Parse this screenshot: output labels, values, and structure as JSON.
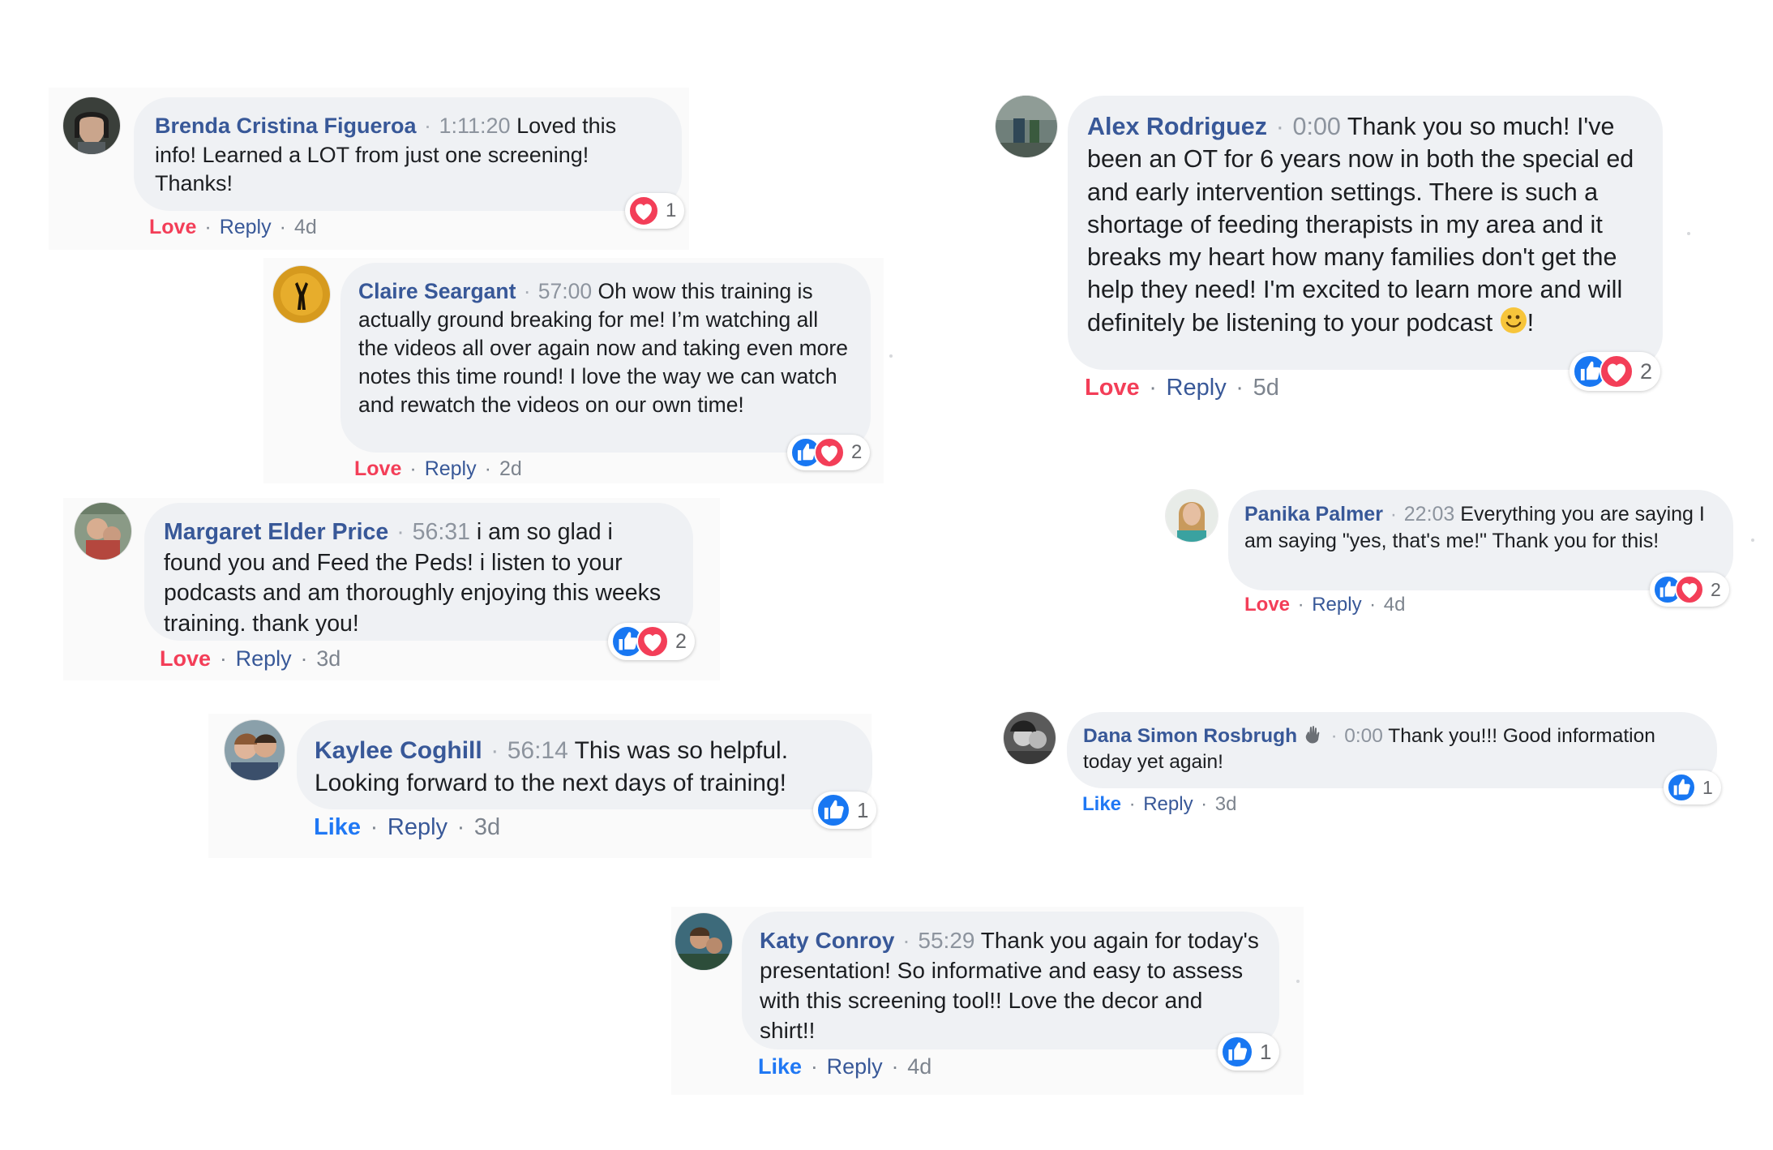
{
  "colors": {
    "bubble": "#eff1f4",
    "author": "#385898",
    "love": "#f33e58",
    "like": "#2078f4",
    "timestamp": "#8d949e"
  },
  "comments": [
    {
      "author": "Brenda Cristina Figueroa",
      "timestamp": "1:11:20",
      "text": "Loved this info! Learned a LOT from just one screening! Thanks!",
      "action": "Love",
      "reply": "Reply",
      "age": "4d",
      "reactions": [
        "love"
      ],
      "reaction_count": "1"
    },
    {
      "author": "Claire Seargant",
      "timestamp": "57:00",
      "text": "Oh wow this training is actually ground breaking for me! I’m watching all the videos all over again now and taking even more notes this time round! I love the way we can watch and rewatch the videos on our own time!",
      "action": "Love",
      "reply": "Reply",
      "age": "2d",
      "reactions": [
        "like",
        "love"
      ],
      "reaction_count": "2"
    },
    {
      "author": "Margaret Elder Price",
      "timestamp": "56:31",
      "text": "i am so glad i found you and Feed the Peds! i listen to your podcasts and am thoroughly enjoying this weeks training. thank you!",
      "action": "Love",
      "reply": "Reply",
      "age": "3d",
      "reactions": [
        "like",
        "love"
      ],
      "reaction_count": "2"
    },
    {
      "author": "Kaylee Coghill",
      "timestamp": "56:14",
      "text": "This was so helpful. Looking forward to the next days of training!",
      "action": "Like",
      "reply": "Reply",
      "age": "3d",
      "reactions": [
        "like"
      ],
      "reaction_count": "1"
    },
    {
      "author": "Katy Conroy",
      "timestamp": "55:29",
      "text": "Thank you again for today's presentation! So informative and easy to assess with this screening tool!! Love the decor and shirt!!",
      "action": "Like",
      "reply": "Reply",
      "age": "4d",
      "reactions": [
        "like"
      ],
      "reaction_count": "1"
    },
    {
      "author": "Alex Rodriguez",
      "timestamp": "0:00",
      "text": "Thank you so much! I've been an OT for 6 years now in both the special ed and early intervention settings. There is such a shortage of feeding therapists in my area and it breaks my heart how many families don't get the help they need! I'm excited to learn more and will definitely be listening to your podcast",
      "text_end": "!",
      "emoji": "slightly-smiling-face-emoji",
      "action": "Love",
      "reply": "Reply",
      "age": "5d",
      "reactions": [
        "like",
        "love"
      ],
      "reaction_count": "2"
    },
    {
      "author": "Panika Palmer",
      "timestamp": "22:03",
      "text": "Everything you are saying I am saying \"yes, that's me!\" Thank you for this!",
      "action": "Love",
      "reply": "Reply",
      "age": "4d",
      "reactions": [
        "like",
        "love"
      ],
      "reaction_count": "2"
    },
    {
      "author": "Dana Simon Rosbrugh",
      "author_icon": "waving-hand-icon",
      "timestamp": "0:00",
      "text": "Thank you!!! Good information today yet again!",
      "action": "Like",
      "reply": "Reply",
      "age": "3d",
      "reactions": [
        "like"
      ],
      "reaction_count": "1"
    }
  ]
}
